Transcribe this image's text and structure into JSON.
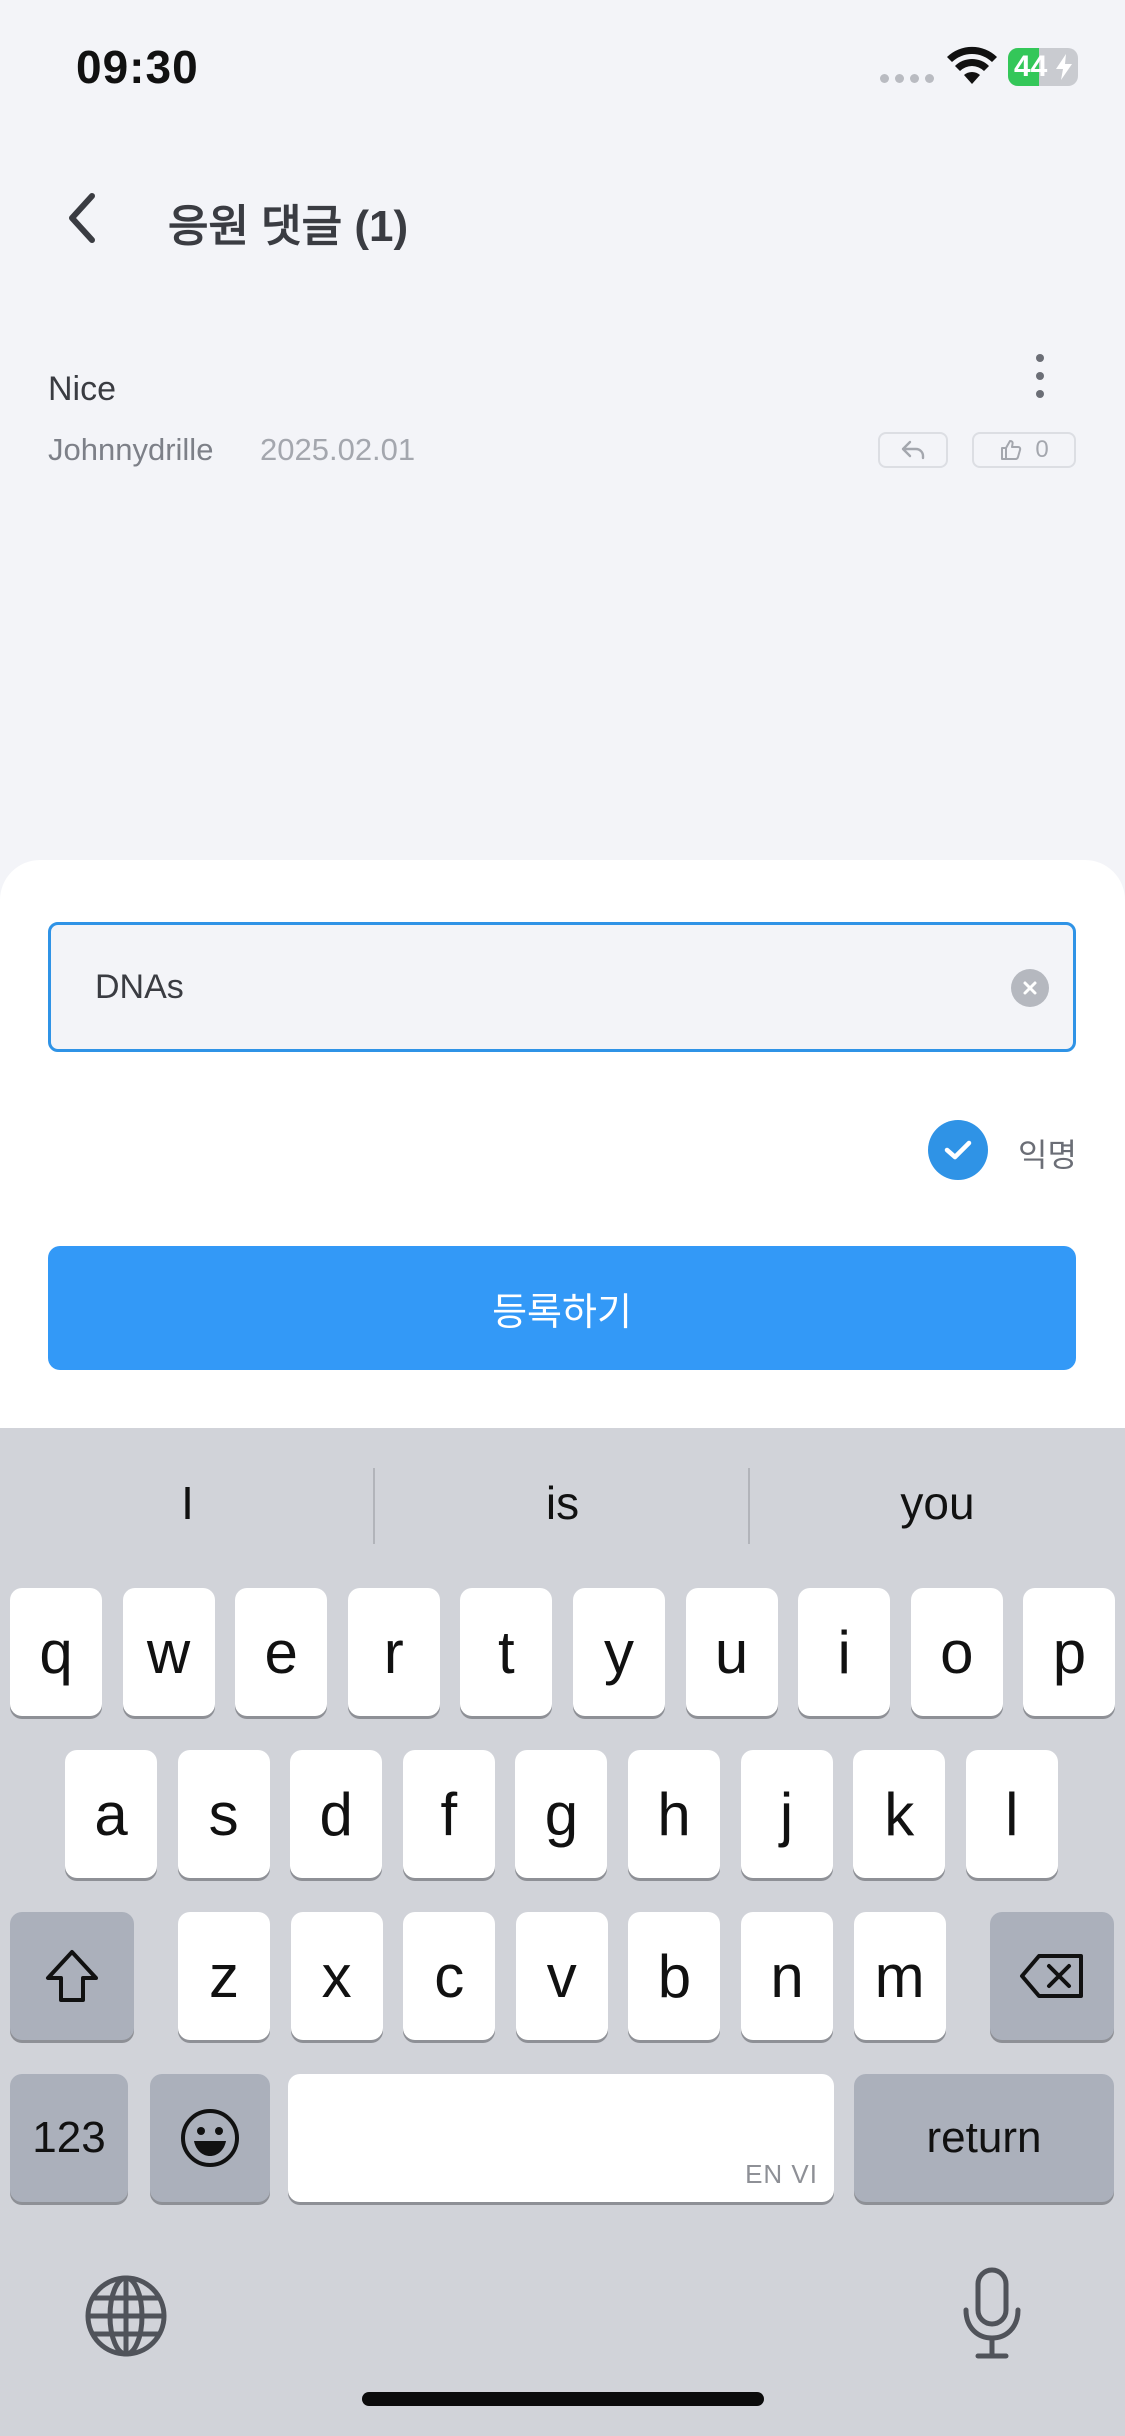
{
  "status_bar": {
    "time": "09:30",
    "battery_level": "44",
    "battery_percent": 44
  },
  "header": {
    "title": "응원 댓글 (1)"
  },
  "comment": {
    "text": "Nice",
    "author": "Johnnydrille",
    "date": "2025.02.01",
    "like_count": "0"
  },
  "composer": {
    "input_value": "DNAs",
    "anonymous_label": "익명",
    "anonymous_checked": true,
    "submit_label": "등록하기"
  },
  "keyboard": {
    "suggestions": [
      "I",
      "is",
      "you"
    ],
    "row1": [
      "q",
      "w",
      "e",
      "r",
      "t",
      "y",
      "u",
      "i",
      "o",
      "p"
    ],
    "row2": [
      "a",
      "s",
      "d",
      "f",
      "g",
      "h",
      "j",
      "k",
      "l"
    ],
    "row3": [
      "z",
      "x",
      "c",
      "v",
      "b",
      "n",
      "m"
    ],
    "numbers_label": "123",
    "return_label": "return",
    "space_sublabel": "EN VI"
  },
  "colors": {
    "accent": "#3399f7",
    "input_border": "#2f93e6",
    "background": "#f3f4f8",
    "keyboard_bg": "#d1d3d9"
  }
}
